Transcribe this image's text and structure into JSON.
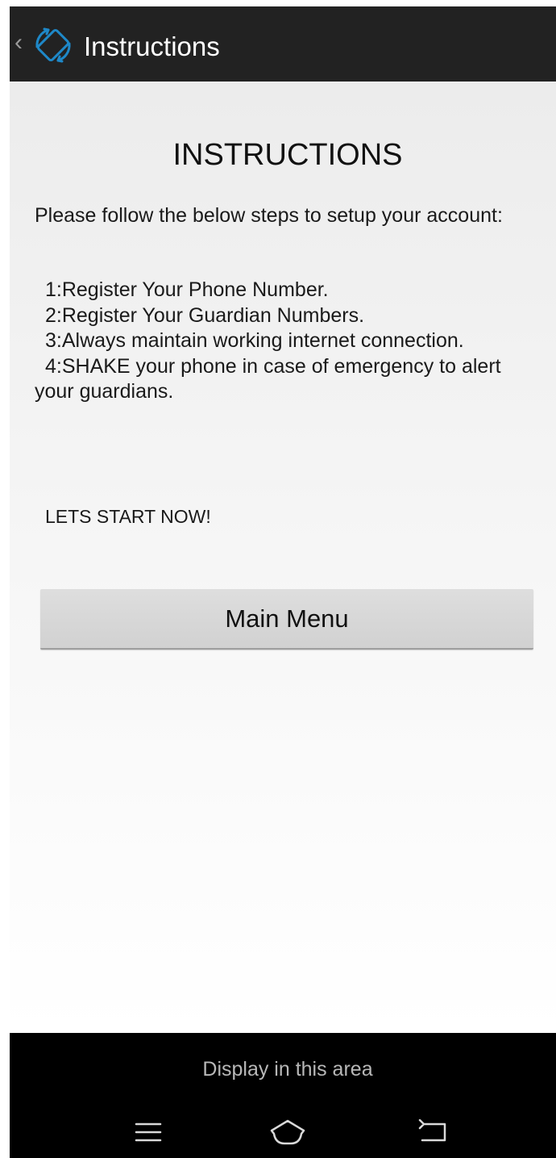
{
  "action_bar": {
    "title": "Instructions",
    "up_icon": "chevron-left-icon",
    "app_icon": "screen-rotation-icon",
    "background": "#222222",
    "icon_color": "#1e88c8"
  },
  "content": {
    "heading": "INSTRUCTIONS",
    "intro": "Please follow the below steps to setup your account:",
    "steps": [
      "1:Register Your Phone Number.",
      "2:Register Your Guardian Numbers.",
      "3:Always maintain working internet connection.",
      "4:SHAKE your phone in case of emergency to alert your guardians."
    ],
    "cta": "LETS START NOW!",
    "main_menu_button": "Main Menu"
  },
  "bottom_area": {
    "display_text": "Display in this area",
    "nav_icons": [
      "menu-icon",
      "home-icon",
      "back-icon"
    ]
  }
}
